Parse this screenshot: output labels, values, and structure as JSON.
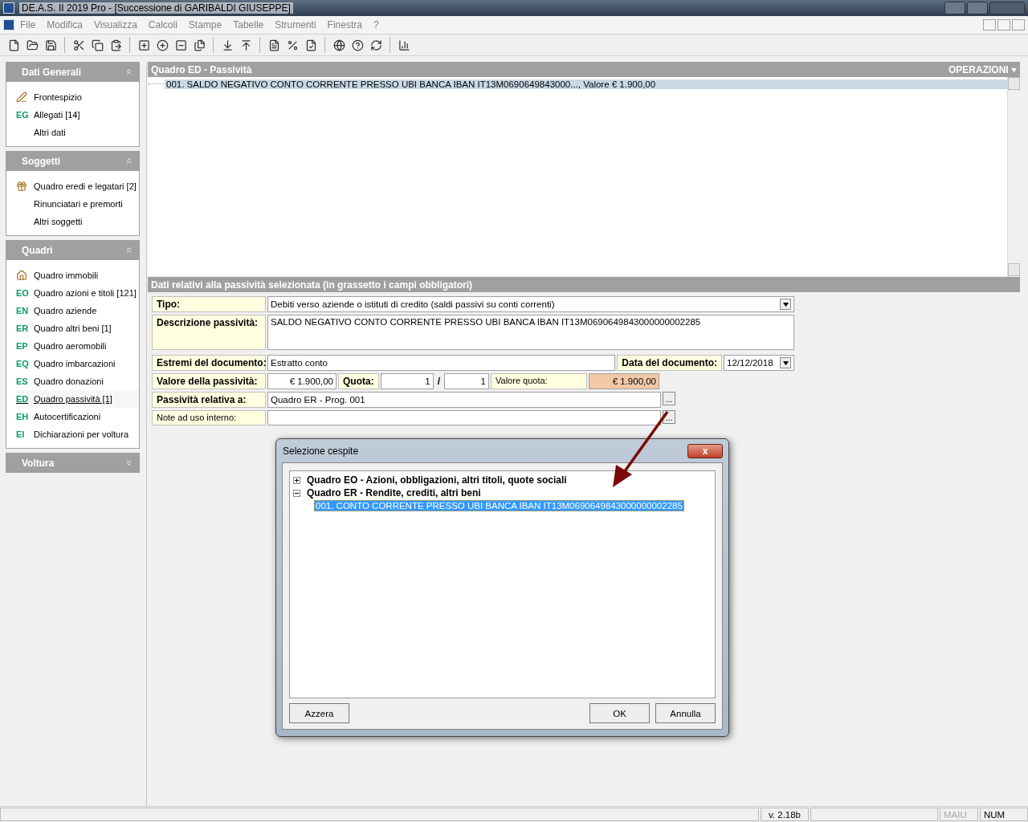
{
  "window": {
    "title": "DE.A.S. II 2019 Pro - [Successione di GARIBALDI GIUSEPPE]"
  },
  "menu": [
    {
      "label": "File"
    },
    {
      "label": "Modifica"
    },
    {
      "label": "Visualizza"
    },
    {
      "label": "Calcoli"
    },
    {
      "label": "Stampe"
    },
    {
      "label": "Tabelle"
    },
    {
      "label": "Strumenti"
    },
    {
      "label": "Finestra"
    },
    {
      "label": "?"
    }
  ],
  "sidebar": {
    "sections": [
      {
        "title": "Dati Generali",
        "expanded": true,
        "items": [
          {
            "kind": "icon",
            "label": "Frontespizio",
            "selected": false
          },
          {
            "kind": "code",
            "code": "EG",
            "label": "Allegati [14]",
            "selected": false
          },
          {
            "kind": "plain",
            "label": "Altri dati",
            "selected": false
          }
        ]
      },
      {
        "title": "Soggetti",
        "expanded": true,
        "items": [
          {
            "kind": "icon",
            "label": "Quadro eredi e legatari [2]",
            "selected": false
          },
          {
            "kind": "plain",
            "label": "Rinunciatari e premorti",
            "selected": false
          },
          {
            "kind": "plain",
            "label": "Altri soggetti",
            "selected": false
          }
        ]
      },
      {
        "title": "Quadri",
        "expanded": true,
        "items": [
          {
            "kind": "icon",
            "label": "Quadro immobili",
            "selected": false
          },
          {
            "kind": "code",
            "code": "EO",
            "label": "Quadro azioni e titoli [121]",
            "selected": false
          },
          {
            "kind": "code",
            "code": "EN",
            "label": "Quadro aziende",
            "selected": false
          },
          {
            "kind": "code",
            "code": "ER",
            "label": "Quadro altri beni [1]",
            "selected": false
          },
          {
            "kind": "code",
            "code": "EP",
            "label": "Quadro aeromobili",
            "selected": false
          },
          {
            "kind": "code",
            "code": "EQ",
            "label": "Quadro imbarcazioni",
            "selected": false
          },
          {
            "kind": "code",
            "code": "ES",
            "label": "Quadro donazioni",
            "selected": false
          },
          {
            "kind": "code",
            "code": "ED",
            "label": "Quadro passività [1]",
            "selected": true
          },
          {
            "kind": "code",
            "code": "EH",
            "label": "Autocertificazioni",
            "selected": false
          },
          {
            "kind": "code",
            "code": "EI",
            "label": "Dichiarazioni per voltura",
            "selected": false
          }
        ]
      },
      {
        "title": "Voltura",
        "expanded": false
      }
    ]
  },
  "list_panel": {
    "title": "Quadro ED - Passività",
    "operations": "OPERAZIONI",
    "rows": [
      {
        "text": "001. SALDO NEGATIVO CONTO CORRENTE PRESSO UBI BANCA IBAN IT13M0690649843000..., Valore € 1.900,00",
        "selected": true
      }
    ]
  },
  "detail": {
    "title": "Dati relativi alla passività selezionata (in grassetto i campi obbligatori)",
    "tipo": {
      "label": "Tipo:",
      "value": "Debiti verso aziende o istituti di credito (saldi passivi su conti correnti)"
    },
    "descrizione": {
      "label": "Descrizione passività:",
      "value": "SALDO NEGATIVO CONTO CORRENTE PRESSO UBI BANCA IBAN IT13M0690649843000000002285"
    },
    "estremi": {
      "label": "Estremi del documento:",
      "value": "Estratto conto"
    },
    "data": {
      "label": "Data del documento:",
      "value": "12/12/2018"
    },
    "valore": {
      "label": "Valore della passività:",
      "value": "€ 1.900,00"
    },
    "quota": {
      "label": "Quota:",
      "numerator": "1",
      "separator": "/",
      "denominator": "1"
    },
    "valore_quota": {
      "label": "Valore quota:",
      "value": "€ 1.900,00"
    },
    "relativa": {
      "label": "Passività relativa a:",
      "value": "Quadro ER - Prog. 001",
      "button": "..."
    },
    "note": {
      "label": "Note ad uso interno:",
      "button": "..."
    }
  },
  "dialog": {
    "title": "Selezione cespite",
    "close": "x",
    "tree": [
      {
        "label": "Quadro EO - Azioni, obbligazioni, altri titoli, quote sociali",
        "expanded": false
      },
      {
        "label": "Quadro ER - Rendite, crediti, altri beni",
        "expanded": true,
        "children": [
          {
            "label": "001. CONTO CORRENTE PRESSO UBI BANCA IBAN IT13M0690649843000000002285",
            "selected": true
          }
        ]
      }
    ],
    "buttons": [
      {
        "label": "Azzera"
      },
      {
        "label": "OK"
      },
      {
        "label": "Annulla"
      }
    ]
  },
  "status_bar": {
    "version": "v. 2.18b",
    "indicators": [
      {
        "text": "MAIU",
        "active": false
      },
      {
        "text": "NUM",
        "active": true
      }
    ]
  }
}
